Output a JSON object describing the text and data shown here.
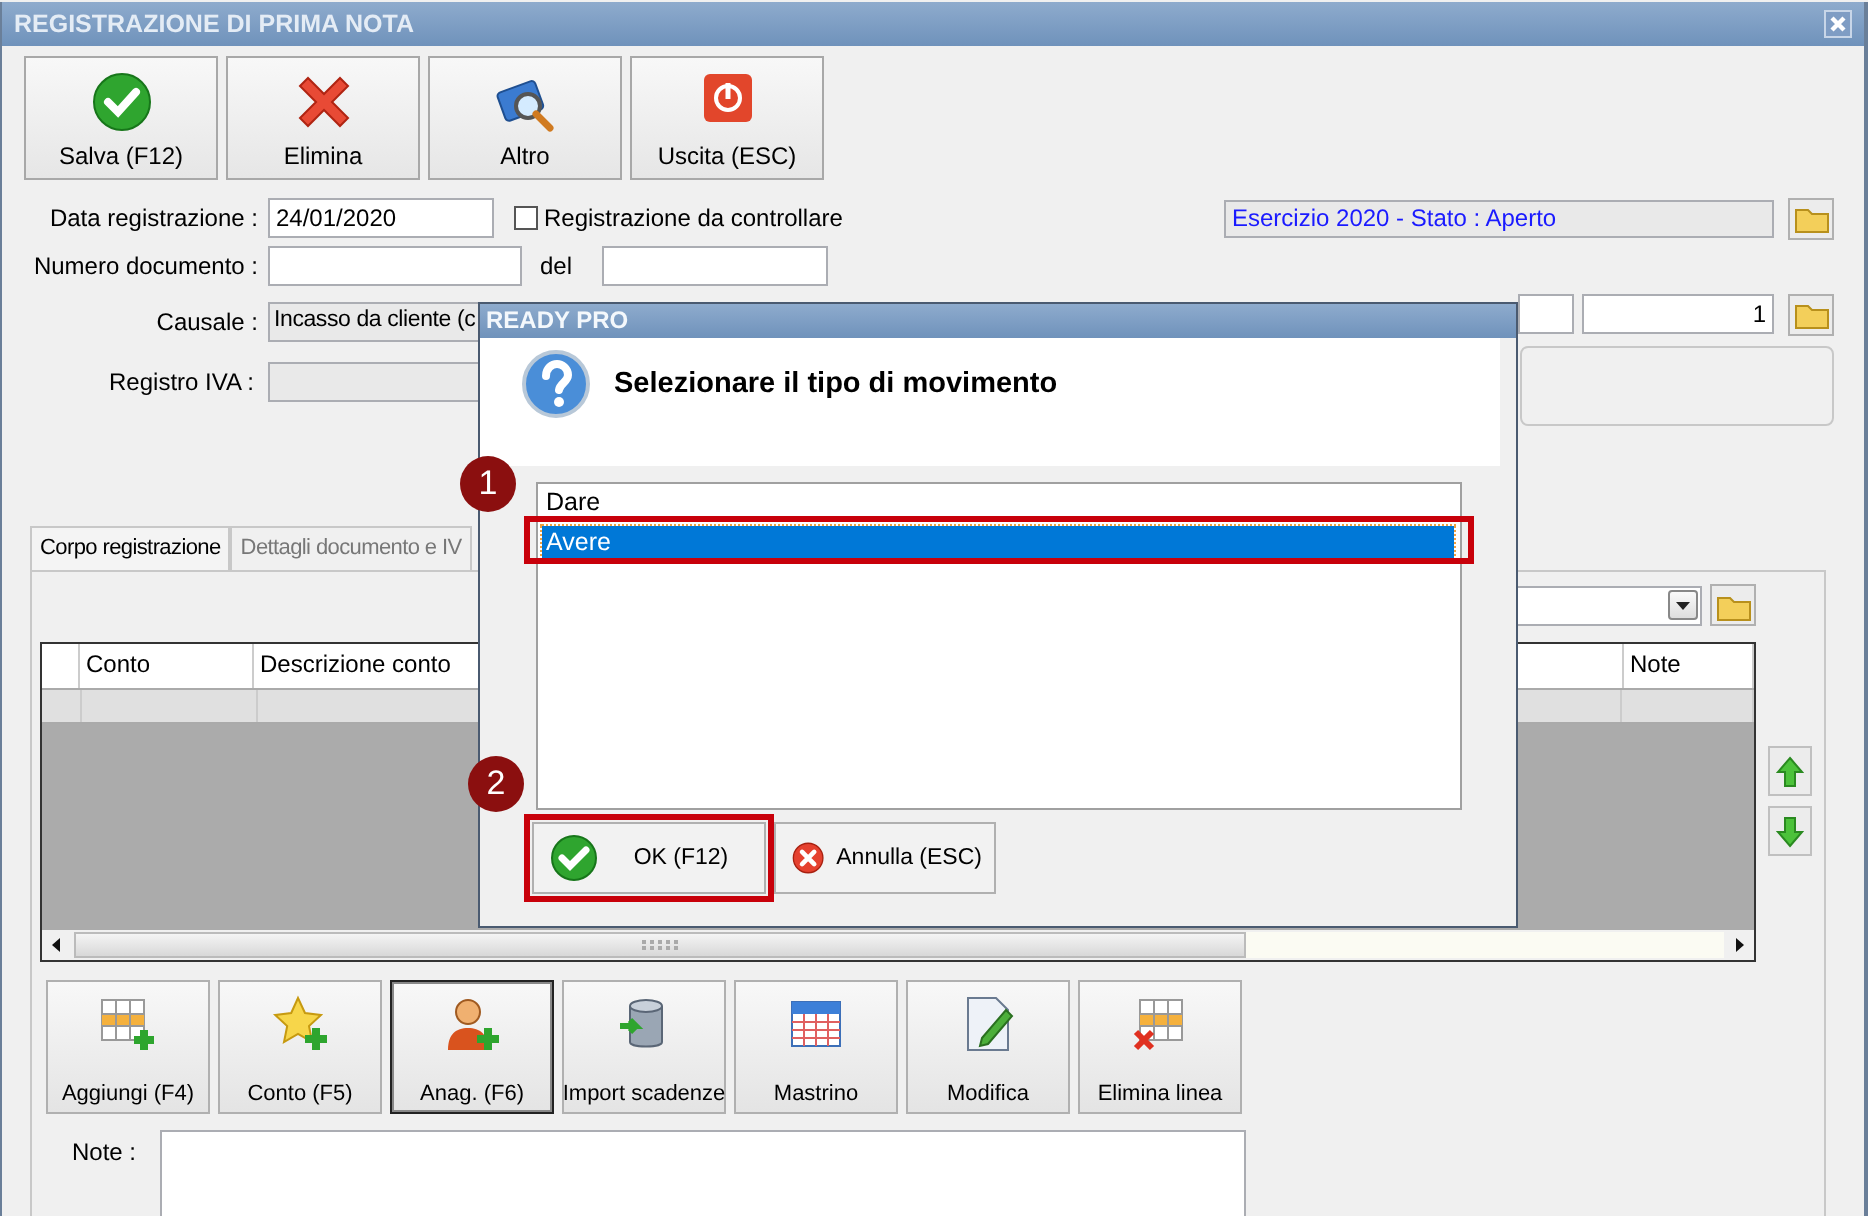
{
  "window": {
    "title": "REGISTRAZIONE DI PRIMA NOTA"
  },
  "toolbar": [
    {
      "label": "Salva (F12)",
      "kind": "save"
    },
    {
      "label": "Elimina",
      "kind": "delete"
    },
    {
      "label": "Altro",
      "kind": "other"
    },
    {
      "label": "Uscita (ESC)",
      "kind": "exit"
    }
  ],
  "form": {
    "data_registrazione": {
      "label": "Data registrazione :",
      "value": "24/01/2020"
    },
    "da_controllare": {
      "label": "Registrazione da controllare",
      "checked": false
    },
    "numero_documento": {
      "label": "Numero documento :"
    },
    "del": {
      "label": "del"
    },
    "causale": {
      "label": "Causale :",
      "value": "Incasso da cliente (c"
    },
    "registro_iva": {
      "label": "Registro IVA :"
    },
    "esercizio": "Esercizio 2020 - Stato : Aperto",
    "numero": "1"
  },
  "tabs": [
    {
      "label": "Corpo registrazione",
      "selected": true
    },
    {
      "label": "Dettagli documento e IV",
      "selected": false
    }
  ],
  "grid": {
    "columns": [
      "Conto",
      "Descrizione conto",
      "Note"
    ]
  },
  "actions": [
    {
      "label": "Aggiungi (F4)",
      "kind": "add",
      "focused": false
    },
    {
      "label": "Conto (F5)",
      "kind": "account",
      "focused": false
    },
    {
      "label": "Anag. (F6)",
      "kind": "contact",
      "focused": true
    },
    {
      "label": "Import scadenze",
      "kind": "import",
      "focused": false
    },
    {
      "label": "Mastrino",
      "kind": "ledger",
      "focused": false
    },
    {
      "label": "Modifica",
      "kind": "edit",
      "focused": false
    },
    {
      "label": "Elimina linea",
      "kind": "remove",
      "focused": false
    }
  ],
  "note": {
    "label": "Note :"
  },
  "dialog": {
    "title": "READY PRO",
    "prompt": "Selezionare il tipo di movimento",
    "options": [
      {
        "label": "Dare",
        "selected": false
      },
      {
        "label": "Avere",
        "selected": true
      }
    ],
    "buttons": [
      {
        "label": "OK (F12)",
        "kind": "ok"
      },
      {
        "label": "Annulla (ESC)",
        "kind": "cancel"
      }
    ]
  },
  "callouts": [
    {
      "number": "1",
      "kind": "option"
    },
    {
      "number": "2",
      "kind": "button"
    }
  ]
}
